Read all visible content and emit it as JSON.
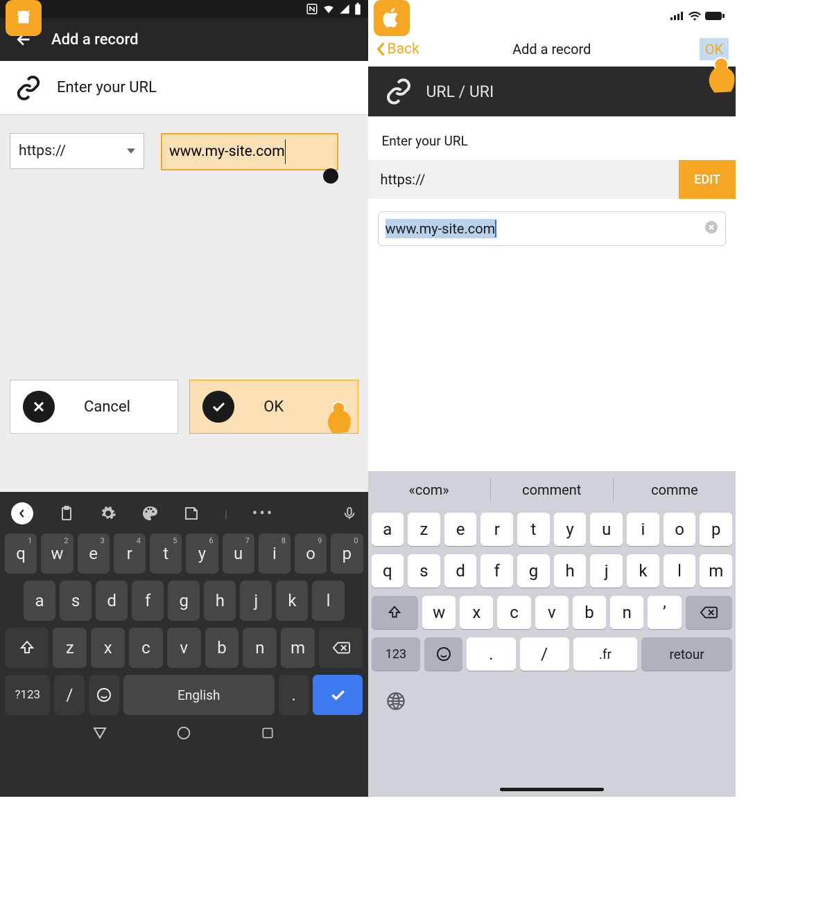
{
  "android": {
    "appbar_title": "Add a record",
    "subhead": "Enter your URL",
    "protocol": "https://",
    "url_value": "www.my-site.com",
    "cancel_label": "Cancel",
    "ok_label": "OK",
    "keyboard": {
      "space_label": "English",
      "switch_label": "?123",
      "row1": [
        "q",
        "w",
        "e",
        "r",
        "t",
        "y",
        "u",
        "i",
        "o",
        "p"
      ],
      "row1_sup": [
        "1",
        "2",
        "3",
        "4",
        "5",
        "6",
        "7",
        "8",
        "9",
        "0"
      ],
      "row2": [
        "a",
        "s",
        "d",
        "f",
        "g",
        "h",
        "j",
        "k",
        "l"
      ],
      "row3": [
        "z",
        "x",
        "c",
        "v",
        "b",
        "n",
        "m"
      ],
      "slash": "/",
      "dot": "."
    }
  },
  "ios": {
    "back_label": "Back",
    "title": "Add a record",
    "ok_label": "OK",
    "section": "URL / URI",
    "enter_label": "Enter your URL",
    "protocol": "https://",
    "edit_label": "EDIT",
    "url_value": "www.my-site.com",
    "suggest": [
      "«com»",
      "comment",
      "comme"
    ],
    "keyboard": {
      "row1": [
        "a",
        "z",
        "e",
        "r",
        "t",
        "y",
        "u",
        "i",
        "o",
        "p"
      ],
      "row2": [
        "q",
        "s",
        "d",
        "f",
        "g",
        "h",
        "j",
        "k",
        "l",
        "m"
      ],
      "row3": [
        "w",
        "x",
        "c",
        "v",
        "b",
        "n",
        "’"
      ],
      "switch_label": "123",
      "dot": ".",
      "slash": "/",
      "fr": ".fr",
      "retour": "retour"
    }
  }
}
